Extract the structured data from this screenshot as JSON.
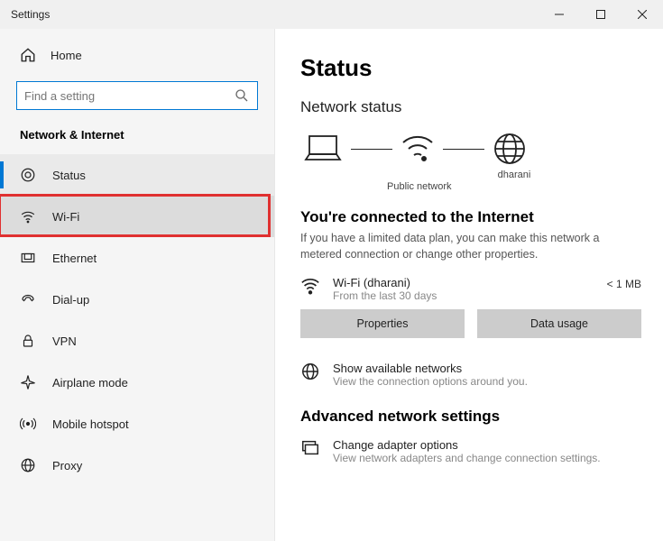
{
  "window": {
    "title": "Settings"
  },
  "sidebar": {
    "home": "Home",
    "search_placeholder": "Find a setting",
    "section": "Network & Internet",
    "items": [
      {
        "icon": "status",
        "label": "Status",
        "active": true
      },
      {
        "icon": "wifi",
        "label": "Wi-Fi",
        "highlighted": true
      },
      {
        "icon": "ethernet",
        "label": "Ethernet"
      },
      {
        "icon": "dialup",
        "label": "Dial-up"
      },
      {
        "icon": "vpn",
        "label": "VPN"
      },
      {
        "icon": "airplane",
        "label": "Airplane mode"
      },
      {
        "icon": "hotspot",
        "label": "Mobile hotspot"
      },
      {
        "icon": "proxy",
        "label": "Proxy"
      }
    ]
  },
  "main": {
    "title": "Status",
    "subtitle": "Network status",
    "diagram": {
      "ssid": "dharani",
      "type": "Public network"
    },
    "connected": {
      "heading": "You're connected to the Internet",
      "desc": "If you have a limited data plan, you can make this network a metered connection or change other properties.",
      "name": "Wi-Fi (dharani)",
      "sub": "From the last 30 days",
      "usage": "< 1 MB",
      "btn_properties": "Properties",
      "btn_usage": "Data usage"
    },
    "show_networks": {
      "title": "Show available networks",
      "sub": "View the connection options around you."
    },
    "advanced_heading": "Advanced network settings",
    "adapter": {
      "title": "Change adapter options",
      "sub": "View network adapters and change connection settings."
    }
  }
}
